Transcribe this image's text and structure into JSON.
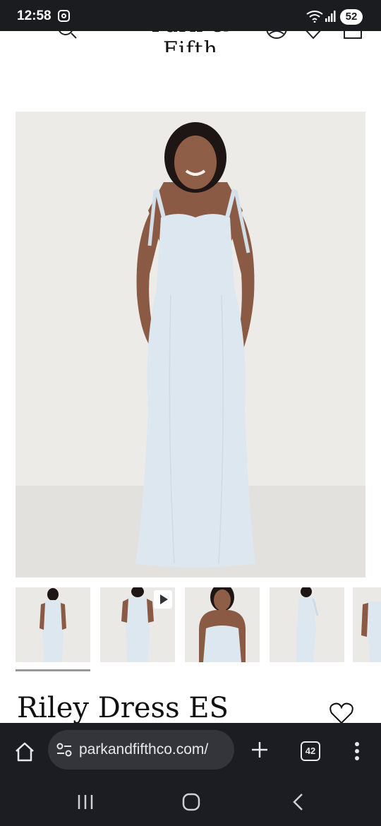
{
  "status_bar": {
    "time": "12:58",
    "battery": "52"
  },
  "header": {
    "logo": "Park & Fifth"
  },
  "product": {
    "title": "Riley Dress ES"
  },
  "gallery": {
    "thumbnails": [
      "front",
      "back-video",
      "front-closeup",
      "side",
      "side-partial"
    ]
  },
  "browser": {
    "url": "parkandfifthco.com/",
    "tab_count": "42"
  },
  "colors": {
    "dress": "#dde7ef",
    "background": "#ebe9e6",
    "browser_bar": "#1c1d22"
  }
}
